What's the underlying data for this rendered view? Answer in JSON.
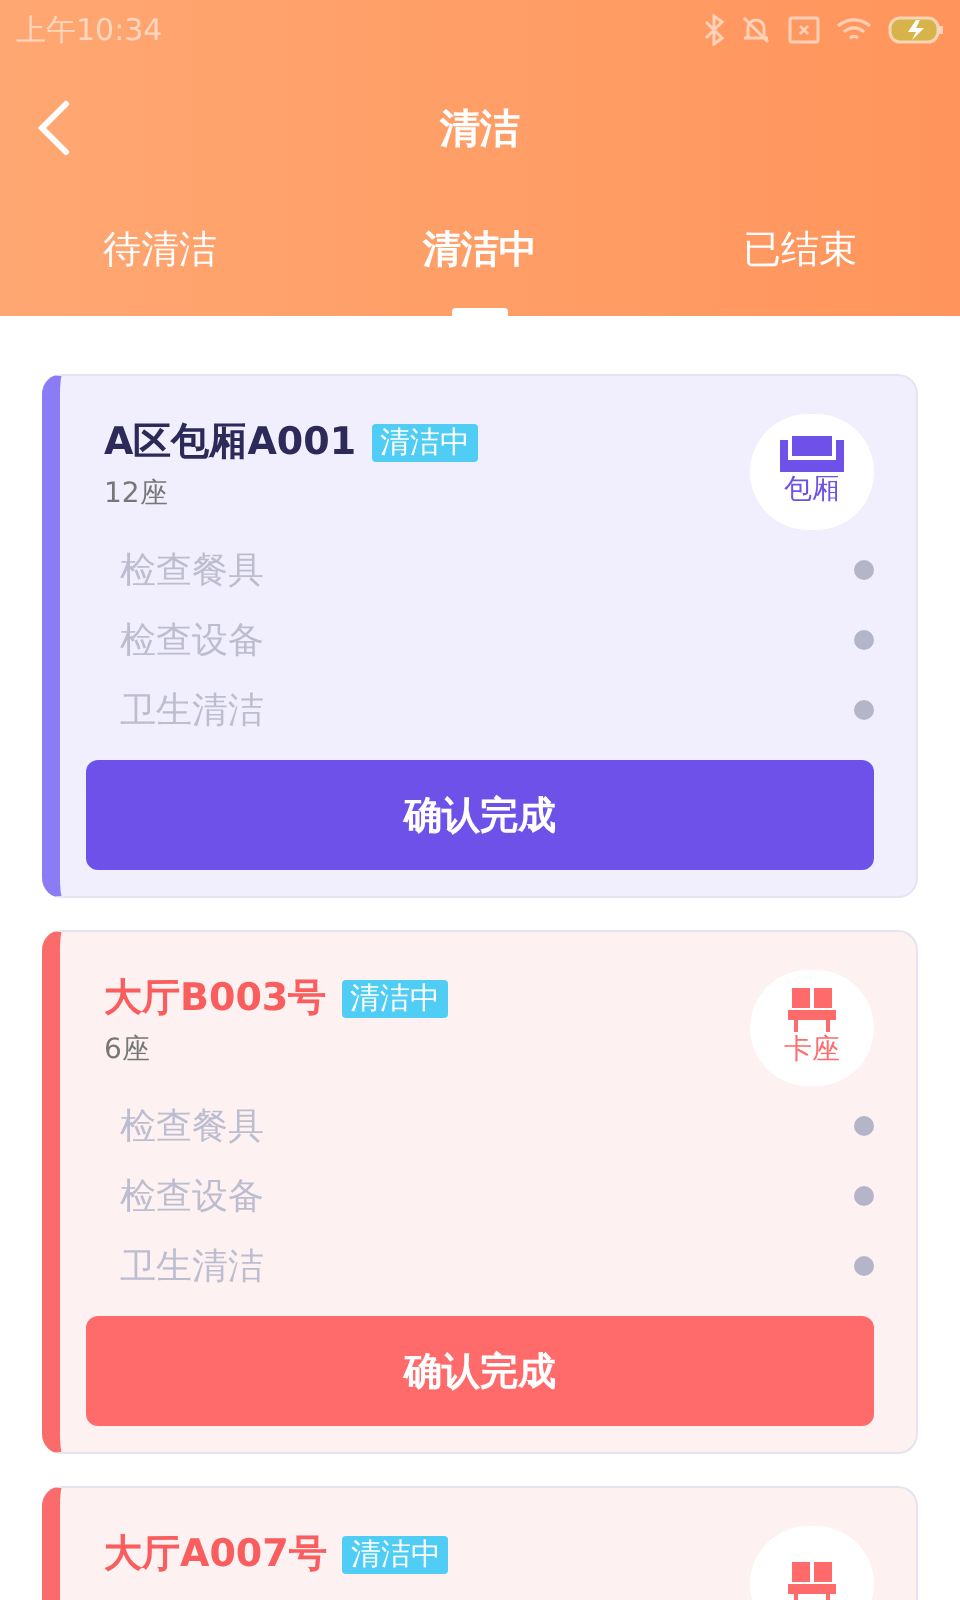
{
  "status_bar": {
    "time": "上午10:34"
  },
  "header": {
    "title": "清洁"
  },
  "tabs": [
    {
      "label": "待清洁",
      "selected": false
    },
    {
      "label": "清洁中",
      "selected": true
    },
    {
      "label": "已结束",
      "selected": false
    }
  ],
  "cards": [
    {
      "kind": "booth",
      "name": "A区包厢A001",
      "status": "清洁中",
      "seats": "12座",
      "type_label": "包厢",
      "tasks": [
        {
          "label": "检查餐具",
          "done": false
        },
        {
          "label": "检查设备",
          "done": false
        },
        {
          "label": "卫生清洁",
          "done": false
        }
      ],
      "button": "确认完成"
    },
    {
      "kind": "hall",
      "name": "大厅B003号",
      "status": "清洁中",
      "seats": "6座",
      "type_label": "卡座",
      "tasks": [
        {
          "label": "检查餐具",
          "done": false
        },
        {
          "label": "检查设备",
          "done": false
        },
        {
          "label": "卫生清洁",
          "done": false
        }
      ],
      "button": "确认完成"
    },
    {
      "kind": "hall",
      "name": "大厅A007号",
      "status": "清洁中"
    }
  ]
}
